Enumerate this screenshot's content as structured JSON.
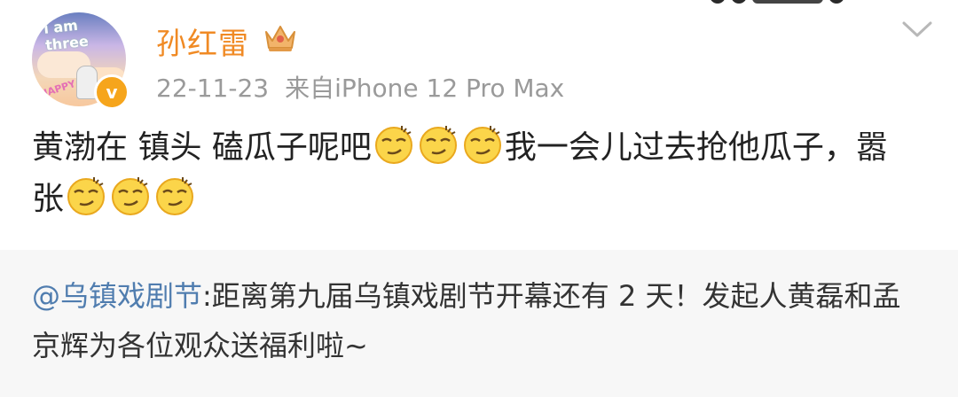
{
  "user": {
    "name": "孙红雷",
    "avatar_text": "i am three",
    "avatar_label": "HAPPY",
    "verified_badge": "v"
  },
  "post": {
    "date": "22-11-23",
    "source": "来自iPhone 12 Pro Max",
    "text_part1": "黄渤在 镇头 磕瓜子呢吧",
    "text_part2": "我一会儿过去抢他瓜子，嚣张"
  },
  "repost": {
    "mention": "@乌镇戏剧节",
    "text": ":距离第九届乌镇戏剧节开幕还有 2 天！发起人黄磊和孟京辉为各位观众送福利啦~"
  },
  "icons": {
    "crown": "crown-icon",
    "expand": "chevron-down-icon",
    "emoji": "smirk-emoji-icon"
  },
  "colors": {
    "username": "#f08a24",
    "mention": "#507daf",
    "meta": "#9a9a9a",
    "repost_bg": "#f7f7f7",
    "badge": "#f6a51c"
  }
}
